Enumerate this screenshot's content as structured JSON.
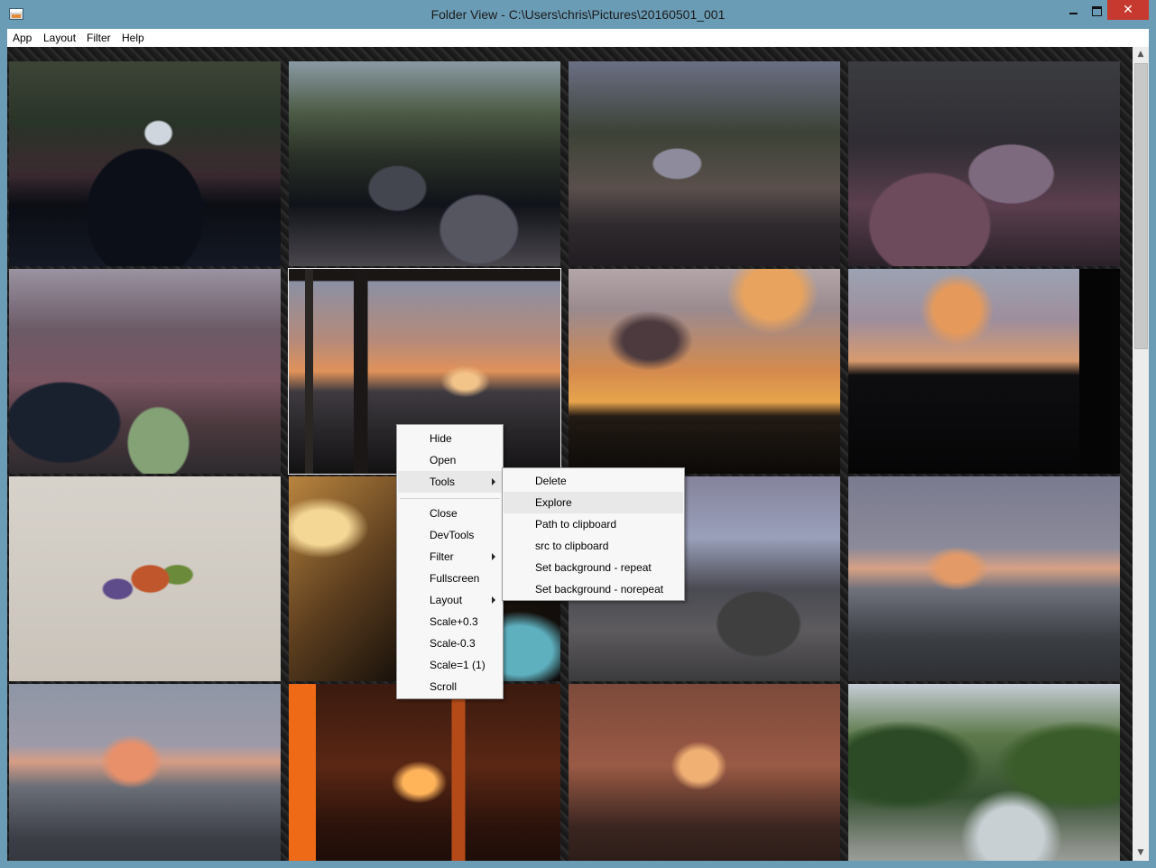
{
  "window": {
    "title": "Folder View - C:\\Users\\chris\\Pictures\\20160501_001",
    "controls": {
      "close": "✕"
    }
  },
  "menubar": {
    "items": [
      "App",
      "Layout",
      "Filter",
      "Help"
    ]
  },
  "thumbnails": [
    "park-pond-waterfall",
    "park-stepping-stones-pond",
    "park-path-trees",
    "park-red-leaves-creek",
    "park-creek-ferns",
    "window-sunset-view",
    "sunset-clouds-silhouette",
    "sunset-clouds-dark",
    "drawing-abstract-sketch",
    "desk-lamp-pencils",
    "street-dusk-houses",
    "street-foggy-sunrise",
    "street-sunrise-fog",
    "orange-room-window",
    "room-window-light",
    "river-rocks-forest"
  ],
  "context_menu": {
    "items": [
      {
        "label": "Hide"
      },
      {
        "label": "Open"
      },
      {
        "label": "Tools",
        "submenu": true,
        "highlighted": true
      },
      {
        "label": "Close"
      },
      {
        "label": "DevTools"
      },
      {
        "label": "Filter",
        "submenu": true
      },
      {
        "label": "Fullscreen"
      },
      {
        "label": "Layout",
        "submenu": true
      },
      {
        "label": "Scale+0.3"
      },
      {
        "label": "Scale-0.3"
      },
      {
        "label": "Scale=1 (1)"
      },
      {
        "label": "Scroll"
      }
    ]
  },
  "tools_submenu": {
    "items": [
      {
        "label": "Delete"
      },
      {
        "label": "Explore",
        "highlighted": true
      },
      {
        "label": "Path to clipboard"
      },
      {
        "label": "src to clipboard"
      },
      {
        "label": "Set background - repeat"
      },
      {
        "label": "Set background - norepeat"
      }
    ]
  }
}
